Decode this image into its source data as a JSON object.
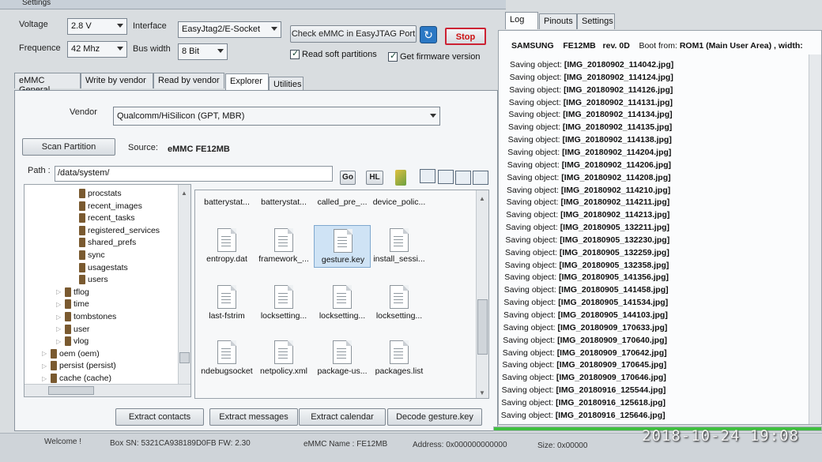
{
  "window": {
    "title": "Settings"
  },
  "settings": {
    "voltage_label": "Voltage",
    "voltage_value": "2.8 V",
    "interface_label": "Interface",
    "interface_value": "EasyJtag2/E-Socket",
    "frequence_label": "Frequence",
    "frequence_value": "42 Mhz",
    "buswidth_label": "Bus width",
    "buswidth_value": "8 Bit",
    "check_button": "Check eMMC in EasyJTAG Port",
    "stop_button": "Stop",
    "read_soft_partitions": "Read soft partitions",
    "get_firmware_version": "Get firmware version"
  },
  "tabs": [
    {
      "label": "eMMC General"
    },
    {
      "label": "Write by vendor"
    },
    {
      "label": "Read by vendor"
    },
    {
      "label": "Explorer"
    },
    {
      "label": "Utilities"
    }
  ],
  "explorer": {
    "vendor_label": "Vendor",
    "vendor_value": "Qualcomm/HiSilicon (GPT, MBR)",
    "scan_button": "Scan Partition",
    "source_label": "Source:",
    "source_value": "eMMC FE12MB",
    "path_label": "Path :",
    "path_value": "/data/system/",
    "go_button": "Go",
    "hl_button": "HL",
    "tree": [
      {
        "label": "procstats",
        "level": 2
      },
      {
        "label": "recent_images",
        "level": 2
      },
      {
        "label": "recent_tasks",
        "level": 2
      },
      {
        "label": "registered_services",
        "level": 2
      },
      {
        "label": "shared_prefs",
        "level": 2
      },
      {
        "label": "sync",
        "level": 2
      },
      {
        "label": "usagestats",
        "level": 2
      },
      {
        "label": "users",
        "level": 2
      },
      {
        "label": "tflog",
        "level": 1
      },
      {
        "label": "time",
        "level": 1
      },
      {
        "label": "tombstones",
        "level": 1
      },
      {
        "label": "user",
        "level": 1
      },
      {
        "label": "vlog",
        "level": 1
      },
      {
        "label": "oem (oem)",
        "level": 0
      },
      {
        "label": "persist (persist)",
        "level": 0
      },
      {
        "label": "cache (cache)",
        "level": 0
      }
    ],
    "files_row0": [
      "batterystat...",
      "batterystat...",
      "called_pre_...",
      "device_polic..."
    ],
    "files": [
      [
        "entropy.dat",
        "framework_...",
        "gesture.key",
        "install_sessi..."
      ],
      [
        "last-fstrim",
        "locksetting...",
        "locksetting...",
        "locksetting..."
      ],
      [
        "ndebugsocket",
        "netpolicy.xml",
        "package-us...",
        "packages.list"
      ]
    ],
    "selected_file": "gesture.key",
    "actions": [
      "Extract contacts",
      "Extract messages",
      "Extract calendar",
      "Decode gesture.key"
    ]
  },
  "right_tabs": [
    {
      "label": "Log"
    },
    {
      "label": "Pinouts"
    },
    {
      "label": "Settings"
    }
  ],
  "log": {
    "header": {
      "vendor": "SAMSUNG",
      "model": "FE12MB",
      "rev": "rev. 0D",
      "boot_label": "Boot from:",
      "boot_value": "ROM1 (Main User Area) , width:"
    },
    "prefix": "Saving object:",
    "entries": [
      "[IMG_20180902_114042.jpg]",
      "[IMG_20180902_114124.jpg]",
      "[IMG_20180902_114126.jpg]",
      "[IMG_20180902_114131.jpg]",
      "[IMG_20180902_114134.jpg]",
      "[IMG_20180902_114135.jpg]",
      "[IMG_20180902_114138.jpg]",
      "[IMG_20180902_114204.jpg]",
      "[IMG_20180902_114206.jpg]",
      "[IMG_20180902_114208.jpg]",
      "[IMG_20180902_114210.jpg]",
      "[IMG_20180902_114211.jpg]",
      "[IMG_20180902_114213.jpg]",
      "[IMG_20180905_132211.jpg]",
      "[IMG_20180905_132230.jpg]",
      "[IMG_20180905_132259.jpg]",
      "[IMG_20180905_132358.jpg]",
      "[IMG_20180905_141356.jpg]",
      "[IMG_20180905_141458.jpg]",
      "[IMG_20180905_141534.jpg]",
      "[IMG_20180905_144103.jpg]",
      "[IMG_20180909_170633.jpg]",
      "[IMG_20180909_170640.jpg]",
      "[IMG_20180909_170642.jpg]",
      "[IMG_20180909_170645.jpg]",
      "[IMG_20180909_170646.jpg]",
      "[IMG_20180916_125544.jpg]",
      "[IMG_20180916_125618.jpg]",
      "[IMG_20180916_125646.jpg]"
    ]
  },
  "statusbar": {
    "welcome": "Welcome !",
    "box_sn": "Box SN:  5321CA938189D0FB  FW:  2.30",
    "emmc_name": "eMMC Name : FE12MB",
    "address": "Address: 0x000000000000",
    "size": "Size: 0x00000"
  },
  "overlay": {
    "timestamp": "2018-10-24 19:08"
  },
  "colors": {
    "stop_text": "#cc1111",
    "progress": "#3fbf3f",
    "selected_file_bg": "#cfe3f5"
  }
}
